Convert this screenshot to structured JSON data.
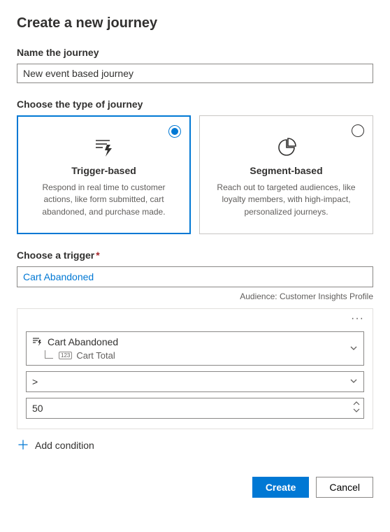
{
  "title": "Create a new journey",
  "name_section": {
    "label": "Name the journey",
    "value": "New event based journey"
  },
  "type_section": {
    "label": "Choose the type of journey",
    "cards": [
      {
        "title": "Trigger-based",
        "desc": "Respond in real time to customer actions, like form submitted, cart abandoned, and purchase made.",
        "selected": true
      },
      {
        "title": "Segment-based",
        "desc": "Reach out to targeted audiences, like loyalty members, with high-impact, personalized journeys.",
        "selected": false
      }
    ]
  },
  "trigger_section": {
    "label": "Choose a trigger",
    "required_mark": "*",
    "value": "Cart Abandoned",
    "audience_label": "Audience: Customer Insights Profile"
  },
  "condition": {
    "event": "Cart Abandoned",
    "attribute": "Cart Total",
    "attr_badge": "123",
    "operator": ">",
    "value": "50",
    "add_label": "Add condition"
  },
  "footer": {
    "create": "Create",
    "cancel": "Cancel"
  }
}
